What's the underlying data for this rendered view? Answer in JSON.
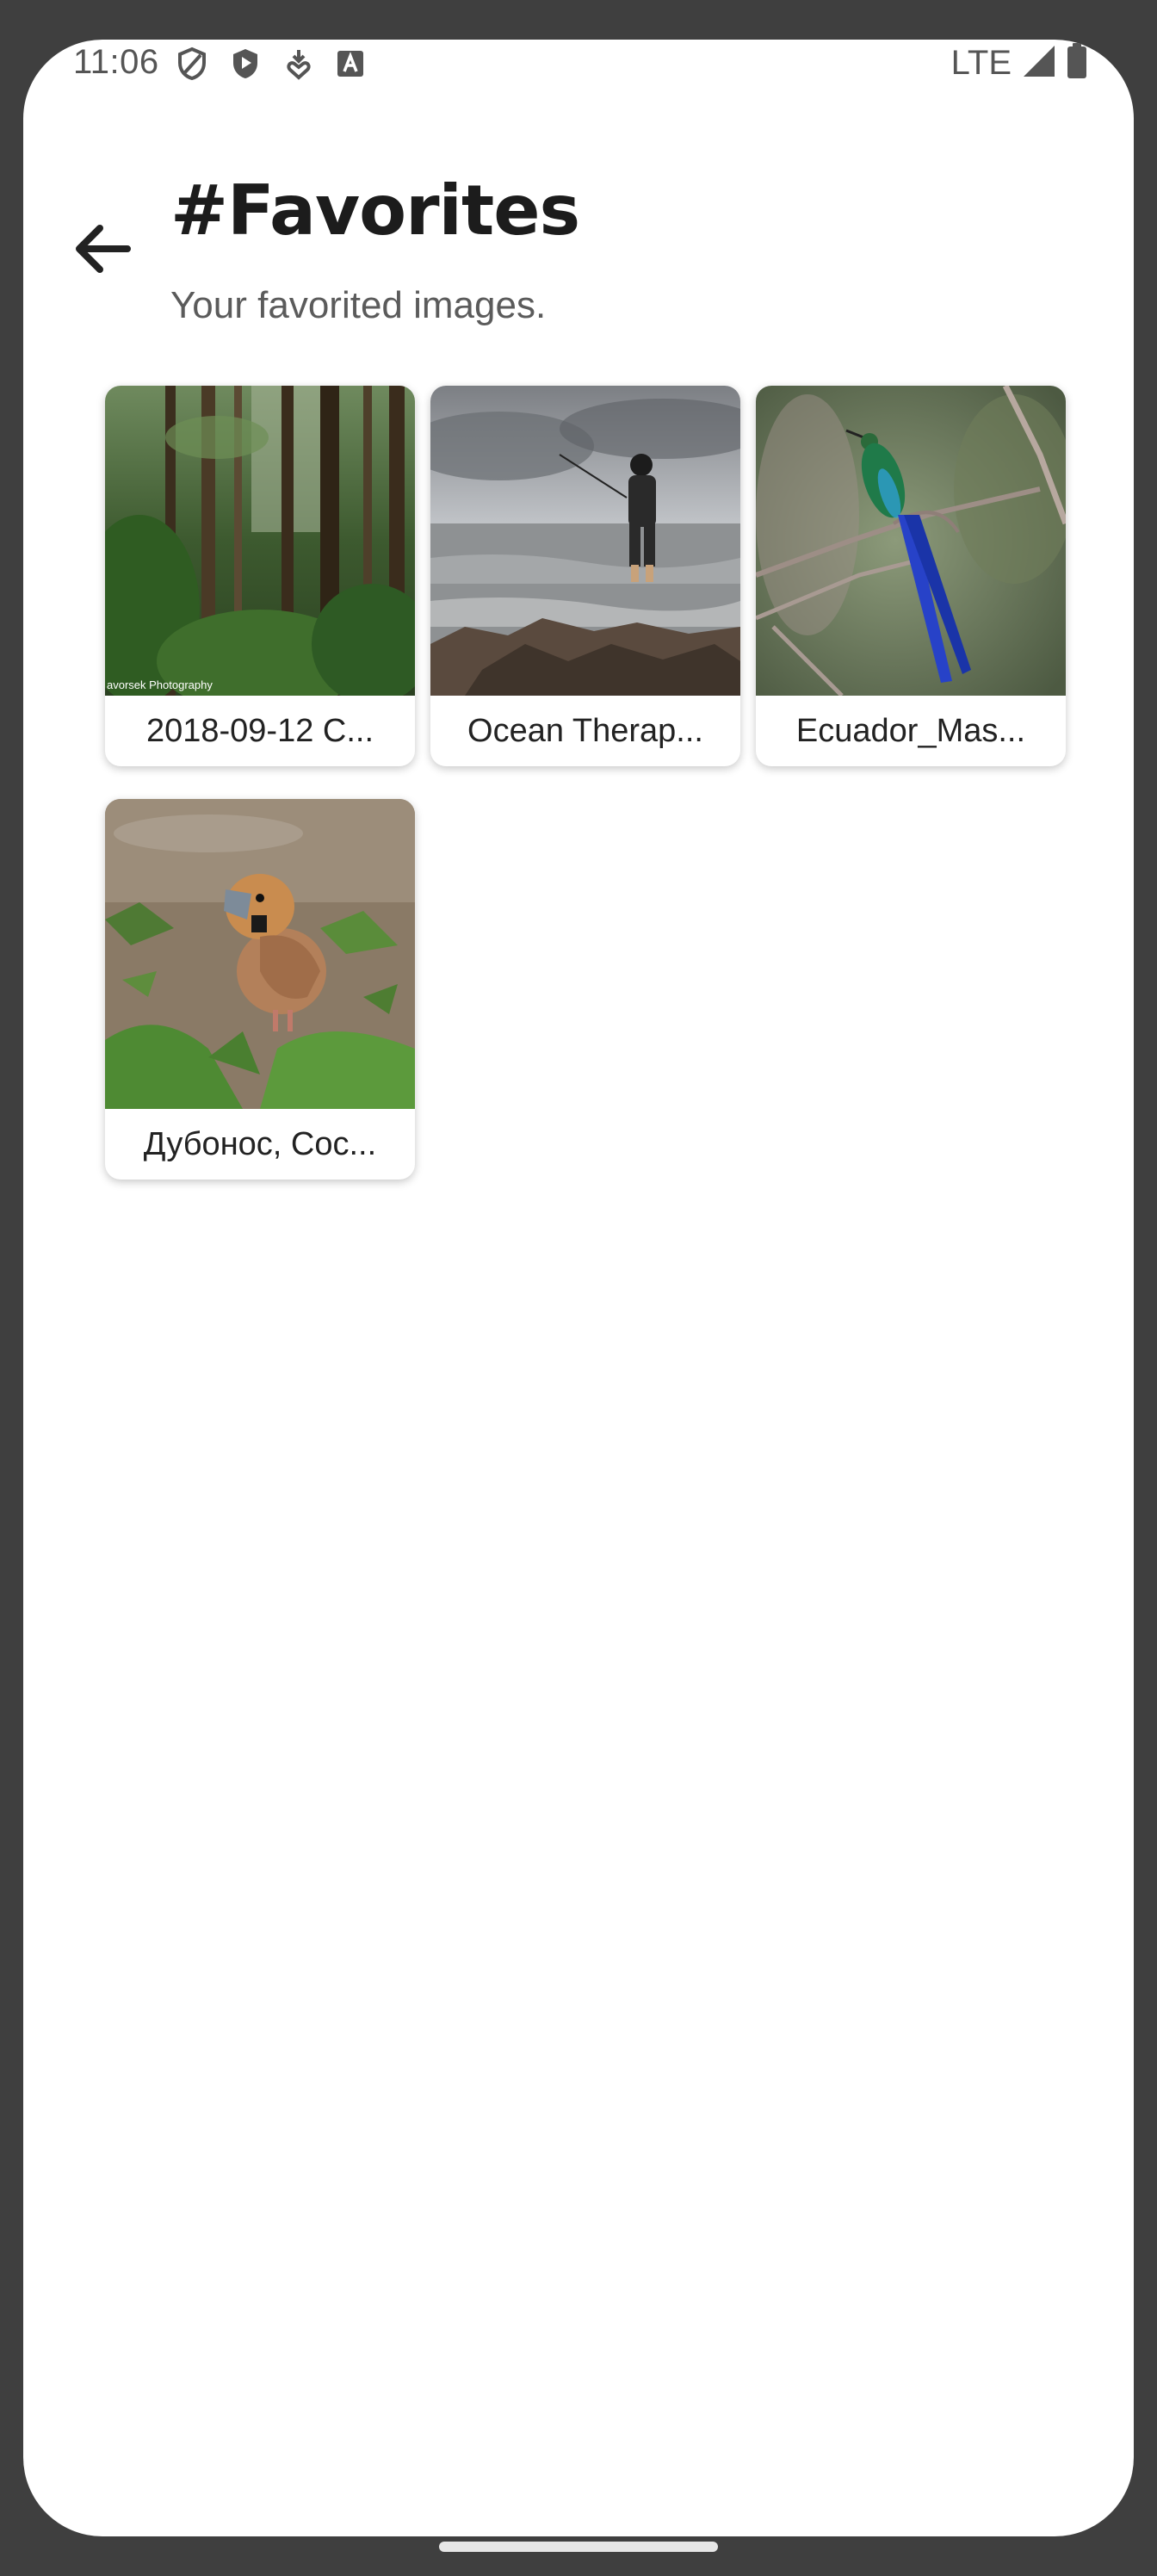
{
  "status_bar": {
    "time": "11:06",
    "network": "LTE",
    "left_icons": [
      "shield-outline-icon",
      "shield-play-icon",
      "download-heart-icon",
      "keyboard-a-icon"
    ],
    "right_icons": [
      "signal-icon",
      "battery-icon"
    ]
  },
  "header": {
    "back_icon": "arrow-left-icon",
    "title": "#Favorites",
    "subtitle": "Your favorited images."
  },
  "favorites": [
    {
      "label": "2018-09-12 C...",
      "thumb": "forest",
      "watermark": "avorsek Photography"
    },
    {
      "label": "Ocean Therap...",
      "thumb": "fisherman"
    },
    {
      "label": "Ecuador_Mas...",
      "thumb": "hummingbird"
    },
    {
      "label": "Дубонос, Coc...",
      "thumb": "hawfinch"
    }
  ],
  "colors": {
    "background_frame": "#3f3f3f",
    "screen": "#ffffff",
    "title": "#1c1c1c",
    "subtitle": "#5b5b5b"
  }
}
